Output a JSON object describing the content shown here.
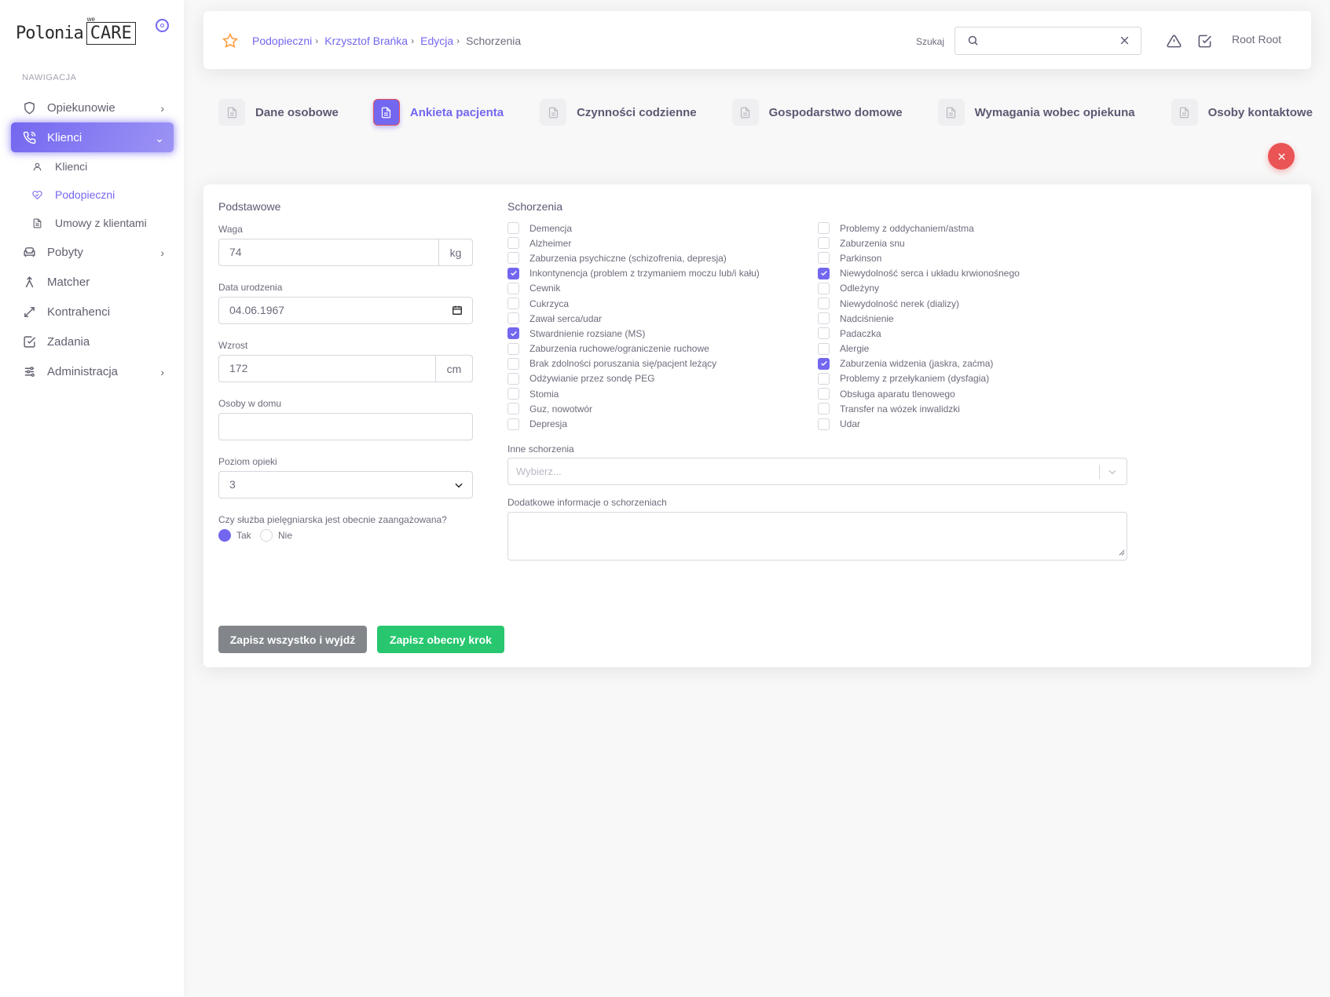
{
  "brand": {
    "logo_left": "Polonia",
    "logo_right": "CARE",
    "logo_tag": "we"
  },
  "sidebar": {
    "header": "NAWIGACJA",
    "items": [
      {
        "label": "Opiekunowie"
      },
      {
        "label": "Klienci"
      },
      {
        "label": "Pobyty"
      },
      {
        "label": "Matcher"
      },
      {
        "label": "Kontrahenci"
      },
      {
        "label": "Zadania"
      },
      {
        "label": "Administracja"
      }
    ],
    "sub_items": [
      {
        "label": "Klienci"
      },
      {
        "label": "Podopieczni"
      },
      {
        "label": "Umowy z klientami"
      }
    ]
  },
  "topbar": {
    "breadcrumb": [
      "Podopieczni",
      "Krzysztof Brańka",
      "Edycja",
      "Schorzenia"
    ],
    "search_label": "Szukaj",
    "search_value": "",
    "user_name": "Root Root"
  },
  "steps": [
    {
      "label": "Dane osobowe"
    },
    {
      "label": "Ankieta pacjenta"
    },
    {
      "label": "Czynności codzienne"
    },
    {
      "label": "Gospodarstwo domowe"
    },
    {
      "label": "Wymagania wobec opiekuna"
    },
    {
      "label": "Osoby kontaktowe"
    }
  ],
  "form": {
    "basic_title": "Podstawowe",
    "weight_label": "Waga",
    "weight_value": "74",
    "weight_unit": "kg",
    "birth_label": "Data urodzenia",
    "birth_value": "04.06.1967",
    "height_label": "Wzrost",
    "height_value": "172",
    "height_unit": "cm",
    "household_label": "Osoby w domu",
    "household_value": "",
    "care_level_label": "Poziom opieki",
    "care_level_value": "3",
    "nursing_question": "Czy służba pielęgniarska jest obecnie zaangażowana?",
    "nursing_yes": "Tak",
    "nursing_no": "Nie",
    "nursing_selected": "Tak",
    "conditions_title": "Schorzenia",
    "conditions_left": [
      {
        "label": "Demencja",
        "checked": false
      },
      {
        "label": "Alzheimer",
        "checked": false
      },
      {
        "label": "Zaburzenia psychiczne (schizofrenia, depresja)",
        "checked": false
      },
      {
        "label": "Inkontynencja (problem z trzymaniem moczu lub/i kału)",
        "checked": true
      },
      {
        "label": "Cewnik",
        "checked": false
      },
      {
        "label": "Cukrzyca",
        "checked": false
      },
      {
        "label": "Zawał serca/udar",
        "checked": false
      },
      {
        "label": "Stwardnienie rozsiane (MS)",
        "checked": true
      },
      {
        "label": "Zaburzenia ruchowe/ograniczenie ruchowe",
        "checked": false
      },
      {
        "label": "Brak zdolności poruszania się/pacjent leżący",
        "checked": false
      },
      {
        "label": "Odżywianie przez sondę PEG",
        "checked": false
      },
      {
        "label": "Stomia",
        "checked": false
      },
      {
        "label": "Guz, nowotwór",
        "checked": false
      },
      {
        "label": "Depresja",
        "checked": false
      }
    ],
    "conditions_right": [
      {
        "label": "Problemy z oddychaniem/astma",
        "checked": false
      },
      {
        "label": "Zaburzenia snu",
        "checked": false
      },
      {
        "label": "Parkinson",
        "checked": false
      },
      {
        "label": "Niewydolność serca i układu krwionośnego",
        "checked": true
      },
      {
        "label": "Odleżyny",
        "checked": false
      },
      {
        "label": "Niewydolność nerek (dializy)",
        "checked": false
      },
      {
        "label": "Nadciśnienie",
        "checked": false
      },
      {
        "label": "Padaczka",
        "checked": false
      },
      {
        "label": "Alergie",
        "checked": false
      },
      {
        "label": "Zaburzenia widzenia (jaskra, zaćma)",
        "checked": true
      },
      {
        "label": "Problemy z przełykaniem (dysfagia)",
        "checked": false
      },
      {
        "label": "Obsługa aparatu tlenowego",
        "checked": false
      },
      {
        "label": "Transfer na wózek inwalidzki",
        "checked": false
      },
      {
        "label": "Udar",
        "checked": false
      }
    ],
    "other_label": "Inne schorzenia",
    "other_placeholder": "Wybierz...",
    "extra_label": "Dodatkowe informacje o schorzeniach",
    "extra_value": "",
    "save_all_label": "Zapisz wszystko i wyjdź",
    "save_step_label": "Zapisz obecny krok"
  },
  "colors": {
    "accent": "#7367f0",
    "danger": "#ea5455",
    "success": "#28c76f",
    "secondary": "#82868b"
  }
}
